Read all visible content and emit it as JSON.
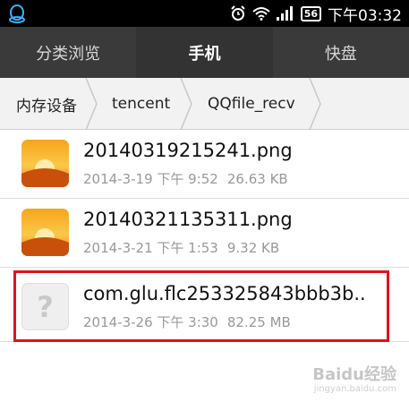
{
  "statusbar": {
    "time": "下午03:32",
    "battery": "56",
    "qq_icon": "qq-penguin-icon",
    "alarm_icon": "alarm-clock-icon",
    "wifi_icon": "wifi-icon",
    "signal_icon": "signal-bars-icon"
  },
  "tabs": [
    {
      "label": "分类浏览",
      "active": false
    },
    {
      "label": "手机",
      "active": true
    },
    {
      "label": "快盘",
      "active": false
    }
  ],
  "breadcrumb": [
    "内存设备",
    "tencent",
    "QQfile_recv"
  ],
  "files": [
    {
      "name": "20140319215241.png",
      "date": "2014-3-19 下午 9:52",
      "size": "26.63 KB",
      "icon": "image-thumbnail-icon"
    },
    {
      "name": "20140321135311.png",
      "date": "2014-3-21 下午 1:53",
      "size": "9.32 KB",
      "icon": "image-thumbnail-icon"
    },
    {
      "name": "com.glu.flc253325843bbb3b..",
      "date": "2014-3-26 下午 3:30",
      "size": "82.25 MB",
      "icon": "unknown-file-icon",
      "icon_glyph": "?"
    }
  ],
  "colors": {
    "highlight": "#e0131c",
    "tabbar": "#3a3a3a"
  },
  "watermark": {
    "logo": "Baidu经验",
    "url": "jingyan.baidu.com"
  }
}
